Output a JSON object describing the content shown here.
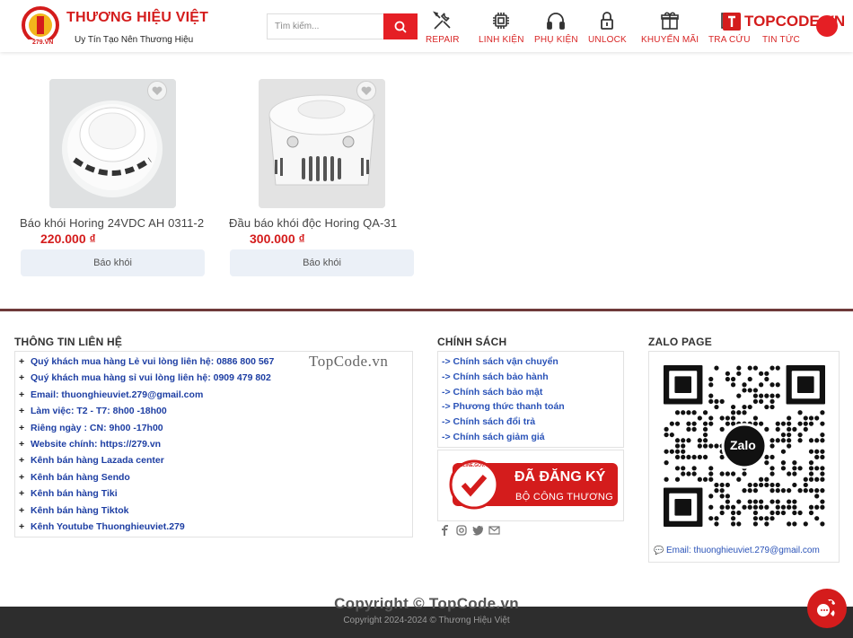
{
  "brand": {
    "logo_text": "279.VN",
    "logo_letter": "I",
    "name": "THƯƠNG HIỆU VIỆT",
    "slogan": "Uy Tín Tạo Nên Thương Hiệu"
  },
  "search": {
    "placeholder": "Tìm kiếm..."
  },
  "nav": [
    {
      "label": "REPAIR",
      "icon": "tools-icon"
    },
    {
      "label": "LINH KIỆN",
      "icon": "chip-icon"
    },
    {
      "label": "PHỤ KIỆN",
      "icon": "headphones-icon"
    },
    {
      "label": "UNLOCK",
      "icon": "lock-icon"
    },
    {
      "label": "KHUYẾN MÃI",
      "icon": "gift-icon"
    },
    {
      "label": "TRA CỨU",
      "icon": "lookup-icon"
    },
    {
      "label": "TIN TỨC",
      "icon": "news-icon"
    }
  ],
  "watermark_top": "TOPCODE.VN",
  "products": [
    {
      "name": "Báo khói Horing 24VDC AH 0311-2",
      "price": "220.000 ₫",
      "category": "Báo khói"
    },
    {
      "name": "Đầu báo khói độc Horing QA-31",
      "price": "300.000 ₫",
      "category": "Báo khói"
    }
  ],
  "footer": {
    "contact_title": "THÔNG TIN LIÊN HỆ",
    "contact_lines": [
      "Quý khách mua hàng Lẻ vui lòng liên hệ: 0886 800 567",
      "Quý khách mua hàng sỉ vui lòng liên hệ: 0909 479 802",
      "Email: thuonghieuviet.279@gmail.com",
      "Làm việc: T2 - T7: 8h00 -18h00",
      "Riêng ngày : CN: 9h00 -17h00",
      "Website chính: https://279.vn",
      "Kênh bán hàng Lazada center",
      "Kênh bán hàng Sendo",
      "Kênh bán hàng Tiki",
      "Kênh bán hàng Tiktok",
      "Kênh Youtube Thuonghieuviet.279"
    ],
    "policy_title": "CHÍNH SÁCH",
    "policy_lines": [
      "-> Chính sách vận chuyển",
      "-> Chính sách bảo hành",
      "-> Chính sách bảo mật",
      "-> Phương thức thanh toán",
      "-> Chính sách đổi trả",
      "-> Chính sách giảm giá"
    ],
    "registered_badge": {
      "top": "ĐÃ ĐĂNG KÝ",
      "bottom": "BỘ CÔNG THƯƠNG",
      "seal": "ONLINE.GOV.VN"
    },
    "zalo_title": "ZALO PAGE",
    "zalo_logo": "Zalo",
    "zalo_email": "Email: thuonghieuviet.279@gmail.com",
    "watermark_mid": "TopCode.vn",
    "copyright_watermark": "Copyright © TopCode.vn",
    "copyright": "Copyright 2024-2024 © Thương Hiệu Việt"
  },
  "colors": {
    "brand_red": "#d41c1c",
    "link_blue": "#1d3ea3",
    "footer_dark": "#2d2d2d"
  }
}
